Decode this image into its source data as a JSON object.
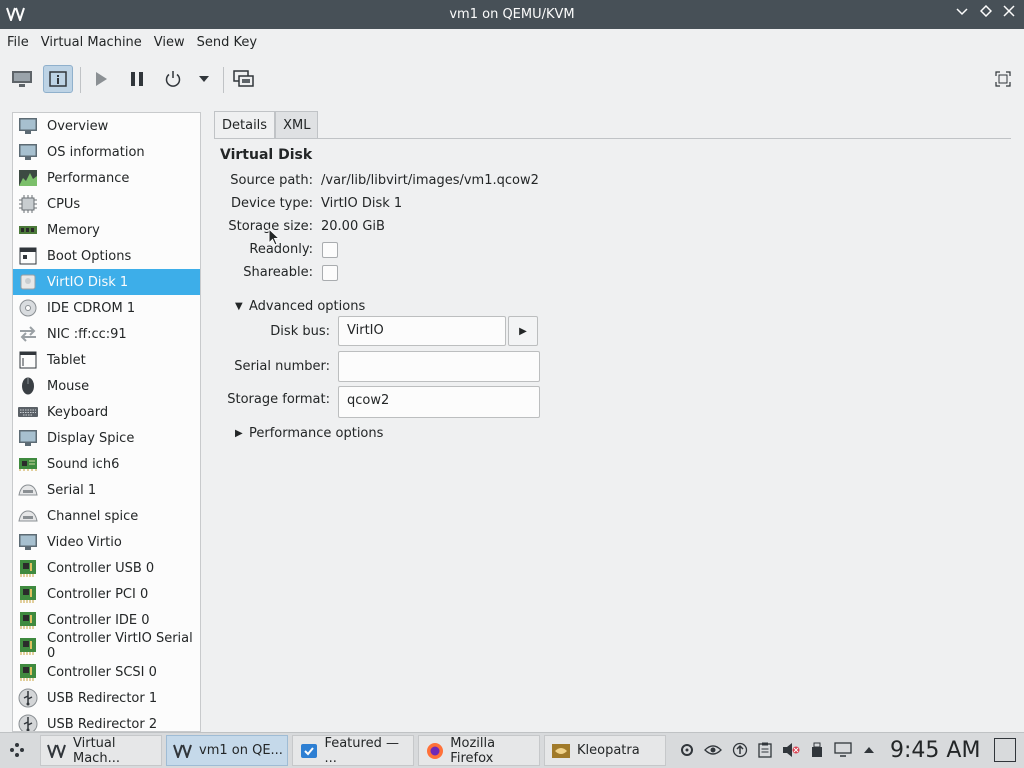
{
  "window": {
    "title": "vm1 on QEMU/KVM"
  },
  "menubar": {
    "items": [
      "File",
      "Virtual Machine",
      "View",
      "Send Key"
    ]
  },
  "sidebar": {
    "items": [
      {
        "label": "Overview",
        "icon": "monitor-icon"
      },
      {
        "label": "OS information",
        "icon": "monitor-icon"
      },
      {
        "label": "Performance",
        "icon": "chart-icon"
      },
      {
        "label": "CPUs",
        "icon": "chip-icon"
      },
      {
        "label": "Memory",
        "icon": "ram-icon"
      },
      {
        "label": "Boot Options",
        "icon": "boot-icon"
      },
      {
        "label": "VirtIO Disk 1",
        "icon": "disk-icon",
        "selected": true
      },
      {
        "label": "IDE CDROM 1",
        "icon": "cdrom-icon"
      },
      {
        "label": "NIC :ff:cc:91",
        "icon": "network-icon"
      },
      {
        "label": "Tablet",
        "icon": "tablet-icon"
      },
      {
        "label": "Mouse",
        "icon": "mouse-icon"
      },
      {
        "label": "Keyboard",
        "icon": "keyboard-icon"
      },
      {
        "label": "Display Spice",
        "icon": "display-icon"
      },
      {
        "label": "Sound ich6",
        "icon": "sound-card-icon"
      },
      {
        "label": "Serial 1",
        "icon": "serial-icon"
      },
      {
        "label": "Channel spice",
        "icon": "channel-icon"
      },
      {
        "label": "Video Virtio",
        "icon": "video-icon"
      },
      {
        "label": "Controller USB 0",
        "icon": "controller-icon"
      },
      {
        "label": "Controller PCI 0",
        "icon": "controller-icon"
      },
      {
        "label": "Controller IDE 0",
        "icon": "controller-icon"
      },
      {
        "label": "Controller VirtIO Serial 0",
        "icon": "controller-icon"
      },
      {
        "label": "Controller SCSI 0",
        "icon": "controller-icon"
      },
      {
        "label": "USB Redirector 1",
        "icon": "usb-icon"
      },
      {
        "label": "USB Redirector 2",
        "icon": "usb-icon"
      }
    ]
  },
  "tabs": [
    {
      "label": "Details",
      "active": true
    },
    {
      "label": "XML",
      "active": false
    }
  ],
  "details": {
    "section_title": "Virtual Disk",
    "source_path_label": "Source path:",
    "source_path": "/var/lib/libvirt/images/vm1.qcow2",
    "device_type_label": "Device type:",
    "device_type": "VirtIO Disk 1",
    "storage_size_label": "Storage size:",
    "storage_size": "20.00 GiB",
    "readonly_label": "Readonly:",
    "readonly": false,
    "shareable_label": "Shareable:",
    "shareable": false,
    "advanced_label": "Advanced options",
    "disk_bus_label": "Disk bus:",
    "disk_bus": "VirtIO",
    "serial_label": "Serial number:",
    "serial_value": "",
    "storage_format_label": "Storage format:",
    "storage_format": "qcow2",
    "performance_label": "Performance options"
  },
  "taskbar": {
    "tasks": [
      {
        "label": "Virtual Mach...",
        "icon": "virt-manager-icon"
      },
      {
        "label": "vm1 on QE...",
        "icon": "virt-manager-icon",
        "active": true
      },
      {
        "label": "Featured — ...",
        "icon": "store-icon"
      },
      {
        "label": "Mozilla Firefox",
        "icon": "firefox-icon"
      },
      {
        "label": "Kleopatra",
        "icon": "kleopatra-icon"
      }
    ],
    "clock": "9:45 AM"
  },
  "colors": {
    "titlebar": "#475057",
    "selection": "#3daee9",
    "window_bg": "#eff0f1",
    "taskbar_bg": "#d8dadc"
  }
}
